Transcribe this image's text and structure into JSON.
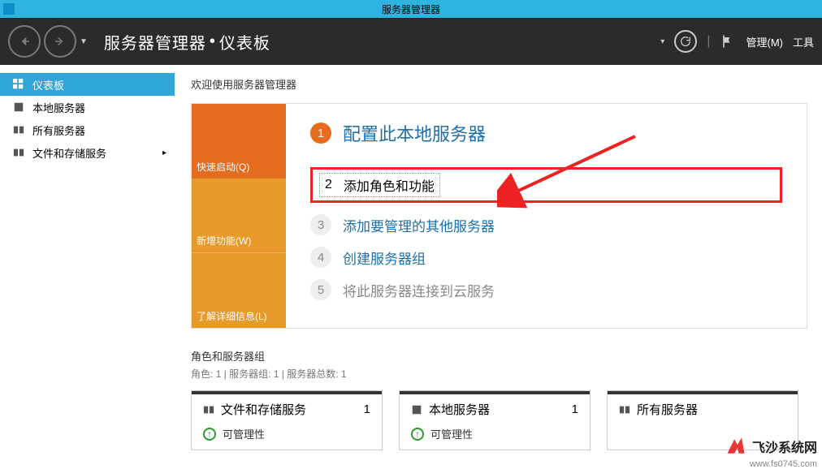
{
  "titlebar": {
    "title": "服务器管理器"
  },
  "header": {
    "breadcrumb_root": "服务器管理器",
    "breadcrumb_page": "仪表板",
    "menu_manage": "管理(M)",
    "menu_tools": "工具"
  },
  "sidebar": {
    "items": [
      {
        "label": "仪表板",
        "active": true
      },
      {
        "label": "本地服务器"
      },
      {
        "label": "所有服务器"
      },
      {
        "label": "文件和存储服务",
        "has_children": true
      }
    ]
  },
  "main": {
    "welcome": "欢迎使用服务器管理器",
    "quicktabs": {
      "t1": "快速启动(Q)",
      "t2": "新增功能(W)",
      "t3": "了解详细信息(L)"
    },
    "steps": {
      "s1": {
        "num": "1",
        "label": "配置此本地服务器"
      },
      "s2": {
        "num": "2",
        "label": "添加角色和功能"
      },
      "s3": {
        "num": "3",
        "label": "添加要管理的其他服务器"
      },
      "s4": {
        "num": "4",
        "label": "创建服务器组"
      },
      "s5": {
        "num": "5",
        "label": "将此服务器连接到云服务"
      }
    },
    "roles": {
      "title": "角色和服务器组",
      "sub": "角色: 1 | 服务器组: 1 | 服务器总数: 1",
      "cards": [
        {
          "title": "文件和存储服务",
          "count": "1",
          "row": "可管理性"
        },
        {
          "title": "本地服务器",
          "count": "1",
          "row": "可管理性"
        },
        {
          "title": "所有服务器",
          "count": "",
          "row": ""
        }
      ]
    }
  },
  "watermark": {
    "brand": "飞沙系统网",
    "url": "www.fs0745.com"
  }
}
